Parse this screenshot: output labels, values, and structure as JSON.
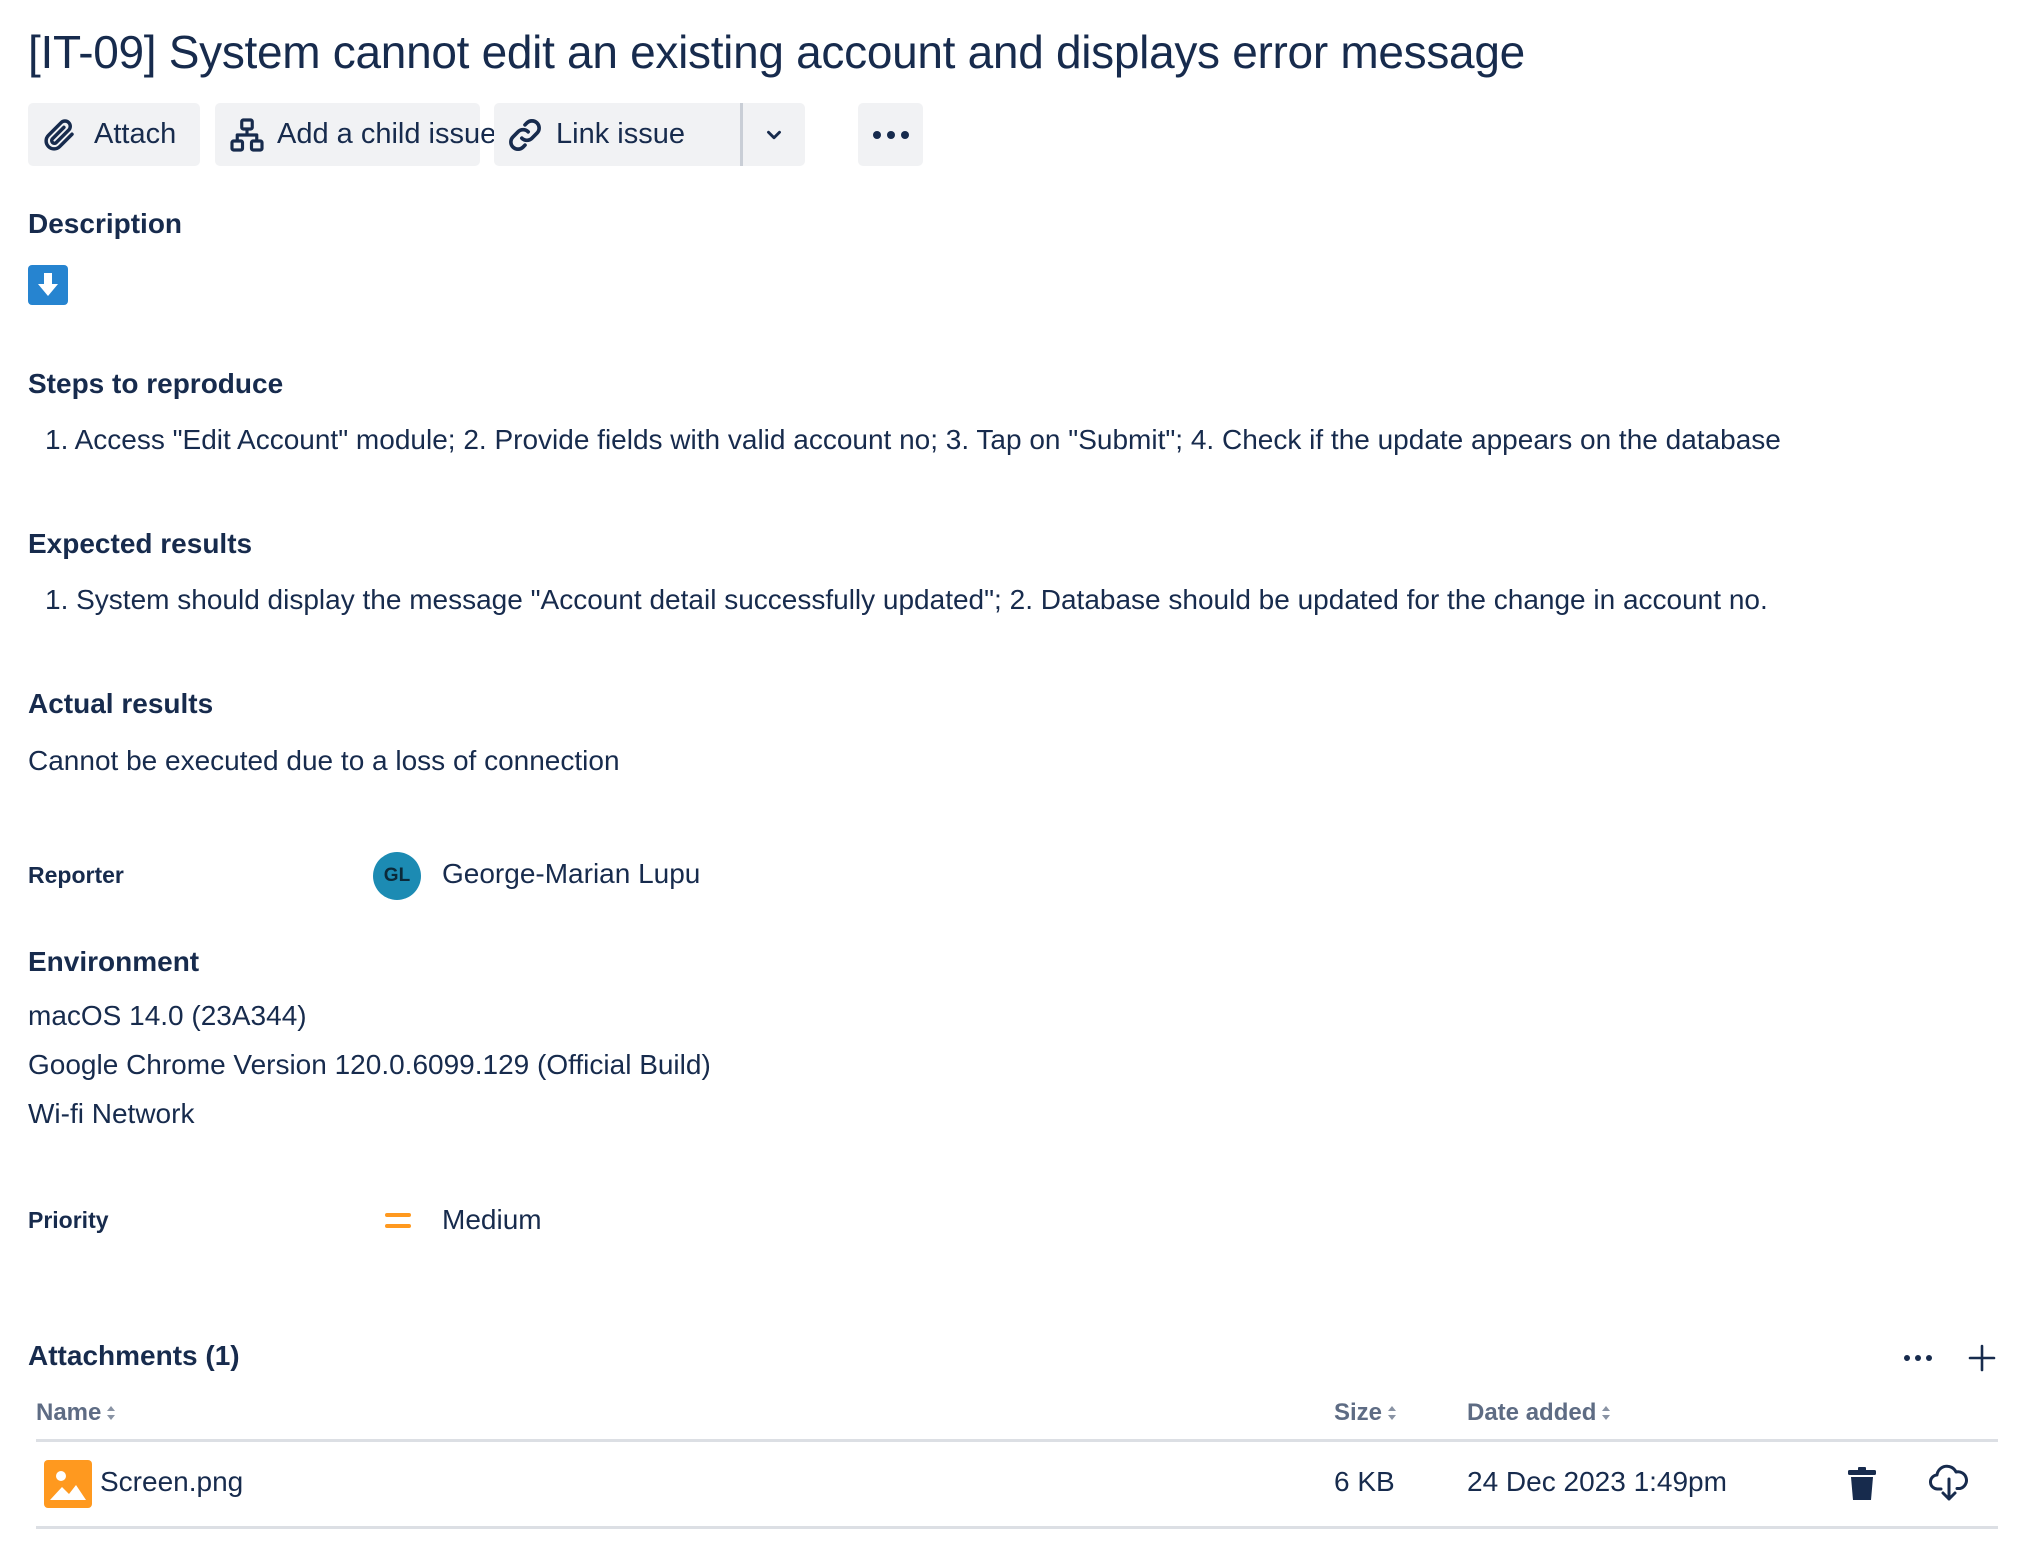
{
  "issue": {
    "title": "[IT-09] System cannot edit an existing account and displays error message"
  },
  "toolbar": {
    "attach_label": "Attach",
    "add_child_label": "Add a child issue",
    "link_issue_label": "Link issue"
  },
  "description": {
    "heading": "Description",
    "steps_heading": "Steps to reproduce",
    "steps_text": "1. Access \"Edit Account\" module; 2. Provide fields with valid account no; 3. Tap on \"Submit\"; 4. Check if the update appears on the database",
    "expected_heading": "Expected results",
    "expected_text": "1. System should display the message \"Account detail successfully updated\"; 2. Database should be updated for the change in account no.",
    "actual_heading": "Actual results",
    "actual_text": "Cannot be executed due to a loss of connection"
  },
  "reporter": {
    "label": "Reporter",
    "initials": "GL",
    "name": "George-Marian Lupu"
  },
  "environment": {
    "heading": "Environment",
    "lines": [
      "macOS 14.0 (23A344)",
      "Google Chrome Version 120.0.6099.129 (Official Build)",
      "Wi-fi Network"
    ]
  },
  "priority": {
    "label": "Priority",
    "value": "Medium",
    "color": "#ff991f"
  },
  "attachments": {
    "heading": "Attachments (1)",
    "columns": {
      "name": "Name",
      "size": "Size",
      "date": "Date added"
    },
    "rows": [
      {
        "name": "Screen.png",
        "size": "6 KB",
        "date": "24 Dec 2023 1:49pm"
      }
    ]
  },
  "colors": {
    "text": "#172b4d",
    "button_bg": "#f1f2f4",
    "avatar_bg": "#1c8bb3",
    "description_icon": "#2684d0",
    "attachment_icon": "#ff991f"
  },
  "icons": {
    "attach": "paperclip-icon",
    "child": "hierarchy-icon",
    "link": "link-icon",
    "dropdown": "chevron-down-icon",
    "more": "more-icon",
    "description": "download-arrow-icon",
    "add": "plus-icon",
    "delete": "trash-icon",
    "download": "cloud-download-icon",
    "file": "image-file-icon"
  }
}
